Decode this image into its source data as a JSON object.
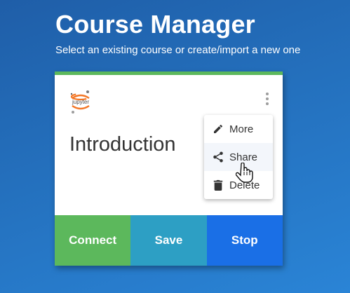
{
  "header": {
    "title": "Course Manager",
    "subtitle": "Select an existing course or create/import a new one"
  },
  "card": {
    "logo_text": "jupyter",
    "title": "Introduction",
    "accent_color": "#5cb85c",
    "actions": {
      "connect_label": "Connect",
      "save_label": "Save",
      "stop_label": "Stop"
    }
  },
  "menu": {
    "items": [
      {
        "label": "More",
        "icon": "pencil-icon"
      },
      {
        "label": "Share",
        "icon": "share-icon",
        "hovered": true
      },
      {
        "label": "Delete",
        "icon": "trash-icon"
      }
    ]
  },
  "colors": {
    "connect": "#5cb85c",
    "save": "#2d9fc4",
    "stop": "#1a6fe6",
    "background": "#2470bd"
  }
}
